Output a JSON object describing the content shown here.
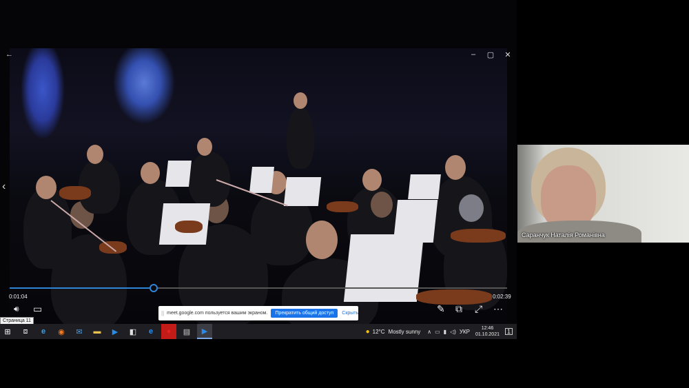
{
  "player": {
    "time_current": "0:01:04",
    "time_total": "0:02:39",
    "progress_fraction": 0.29,
    "page_tooltip": "Страница 11"
  },
  "share_banner": {
    "grip": "||",
    "text": "meet.google.com пользуется вашим экраном.",
    "stop_button": "Прекратить общий доступ",
    "hide_button": "Скрыть"
  },
  "taskbar": {
    "weather_temp": "12°C",
    "weather_text": "Mostly sunny",
    "language": "УКР",
    "time": "12:46",
    "date": "01.10.2021",
    "notification_count": "1"
  },
  "participant": {
    "name": "Саранчук Наталія Романівна"
  },
  "icons": {
    "back": "←",
    "prev": "‹",
    "minimize": "–",
    "maximize": "▢",
    "close": "✕",
    "volume": "🔊︎",
    "subtitles": "▭",
    "edit": "✎",
    "miniplayer": "⧉",
    "fullscreen": "⤢",
    "more": "⋯",
    "windows": "⊞",
    "task_view": "⧈",
    "edge": "e",
    "firefox": "◉",
    "mail": "✉",
    "explorer": "▬",
    "media_player": "▶",
    "store": "◧",
    "ie": "e",
    "opera": "●",
    "app": "▤",
    "films": "▶",
    "chevron_up": "∧",
    "network": "▭",
    "battery": "▮",
    "speaker": "◁)",
    "notifications": "▭"
  },
  "colors": {
    "accent": "#1a73e8",
    "seek": "#2f86d8",
    "taskbar": "#1f1f23"
  }
}
